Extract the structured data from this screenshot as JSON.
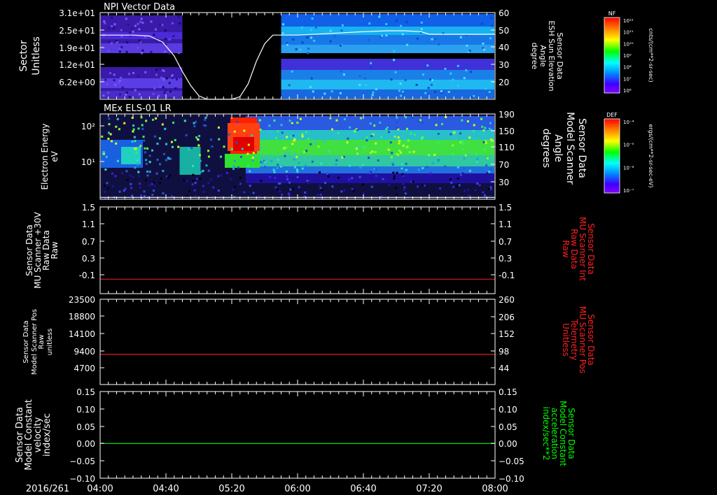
{
  "date_label": "2016/261",
  "time_axis": {
    "start": "04:00",
    "end": "08:00",
    "major_labels": [
      "04:00",
      "04:40",
      "05:20",
      "06:00",
      "06:40",
      "07:20",
      "08:00"
    ]
  },
  "colors": {
    "npi_trace": "#ffffff",
    "mu_int": "#e02020",
    "mu_pos": "#e02020",
    "accel": "#00e000",
    "right_label_red": "#ff2020",
    "right_label_green": "#00ff00"
  },
  "chart_data": [
    {
      "id": "npi",
      "type": "heatmap",
      "title": "NPI Vector Data",
      "ylabel": [
        "Sector",
        "Unitless"
      ],
      "y_ticks": [
        "3.1e+01",
        "2.5e+01",
        "1.9e+01",
        "1.2e+01",
        "6.2e+00"
      ],
      "ylabel_right": [
        "Sensor Data",
        "ESH Sun Elevation",
        "Angle",
        "degree"
      ],
      "y2_ticks": [
        "60",
        "50",
        "40",
        "30",
        "20"
      ],
      "ylim_right": [
        10,
        60
      ],
      "colorbar": {
        "title": "NF",
        "units": "cnts/(cm**2-sr-sec)",
        "tick_labels": [
          "10¹²",
          "10¹¹",
          "10¹⁰",
          "10⁹",
          "10⁸",
          "10⁷",
          "10⁶"
        ]
      },
      "series": [
        {
          "name": "ESH Sun Elevation Angle",
          "x": [
            "04:00",
            "04:20",
            "04:30",
            "04:38",
            "04:45",
            "04:50",
            "04:55",
            "05:00",
            "05:05",
            "05:10",
            "05:15",
            "05:20",
            "05:25",
            "05:30",
            "05:35",
            "05:40",
            "05:45",
            "05:50",
            "06:00",
            "06:20",
            "06:40",
            "06:55",
            "07:05",
            "07:15",
            "07:20",
            "08:00"
          ],
          "values": [
            47,
            47,
            46.5,
            43,
            35,
            26,
            18,
            12,
            10,
            10,
            10,
            10,
            11.5,
            19,
            32,
            42,
            47,
            47,
            47,
            48,
            49,
            49.5,
            49.5,
            49,
            47.5,
            47.5
          ]
        }
      ]
    },
    {
      "id": "els",
      "type": "heatmap",
      "title": "MEx ELS-01 LR",
      "ylabel": [
        "Electron Energy",
        "eV"
      ],
      "y_ticks": [
        "10²",
        "10¹"
      ],
      "ylabel_right": [
        "Sensor Data",
        "Model Scanner",
        "Angle",
        "degrees"
      ],
      "y2_ticks": [
        "190",
        "150",
        "110",
        "70",
        "30"
      ],
      "ylim_right": [
        10,
        190
      ],
      "colorbar": {
        "title": "DEF",
        "units": "ergs/(cm**2-sr-sec-eV)",
        "tick_labels": [
          "10⁻⁴",
          "10⁻⁵",
          "10⁻⁶",
          "10⁻⁷"
        ]
      },
      "series": [
        {
          "name": "Model Scanner Angle",
          "x": [
            "04:00",
            "08:00"
          ],
          "values": [
            14,
            14
          ]
        }
      ]
    },
    {
      "id": "mu_int",
      "type": "line",
      "ylabel": [
        "Sensor Data",
        "MU Scanner +30V",
        "Raw Data",
        "Raw"
      ],
      "y_ticks": [
        "1.5",
        "1.1",
        "0.7",
        "0.3",
        "-0.1"
      ],
      "ylim": [
        -0.3,
        1.5
      ],
      "ylabel_right": [
        "Sensor Data",
        "MU Scanner Int",
        "Raw Data",
        "Raw"
      ],
      "y2_ticks": [
        "1.5",
        "1.1",
        "0.7",
        "0.3",
        "-0.1"
      ],
      "series": [
        {
          "name": "MU Scanner Int Raw Data",
          "x": [
            "04:00",
            "08:00"
          ],
          "values": [
            0.0,
            0.0
          ]
        }
      ]
    },
    {
      "id": "mu_pos",
      "type": "line",
      "ylabel": [
        "Sensor Data",
        "Model Scanner Pos",
        "Raw",
        "unitless"
      ],
      "y_ticks": [
        "23500",
        "18800",
        "14100",
        "9400",
        "4700"
      ],
      "ylim": [
        0,
        23500
      ],
      "ylabel_right": [
        "Sensor Data",
        "MU Scanner Pos",
        "Telemetry",
        "Unitless"
      ],
      "y2_ticks": [
        "260",
        "206",
        "152",
        "98",
        "44"
      ],
      "series": [
        {
          "name": "MU Scanner Pos Telemetry",
          "x": [
            "04:00",
            "08:00"
          ],
          "values": [
            8300,
            8300
          ]
        }
      ]
    },
    {
      "id": "accel",
      "type": "line",
      "ylabel": [
        "Sensor Data",
        "Model Constant",
        "velocity",
        "index/sec"
      ],
      "y_ticks": [
        "0.15",
        "0.10",
        "0.05",
        "0.00",
        "−0.05",
        "−0.10"
      ],
      "ylim": [
        -0.1,
        0.15
      ],
      "ylabel_right": [
        "Sensor Data",
        "Model Constant",
        "acceleration",
        "index/sec**2"
      ],
      "y2_ticks": [
        "0.15",
        "0.10",
        "0.05",
        "0.00",
        "−0.05",
        "−0.10"
      ],
      "series": [
        {
          "name": "Model Constant acceleration",
          "x": [
            "04:00",
            "08:00"
          ],
          "values": [
            0.0,
            0.0
          ]
        }
      ]
    }
  ]
}
